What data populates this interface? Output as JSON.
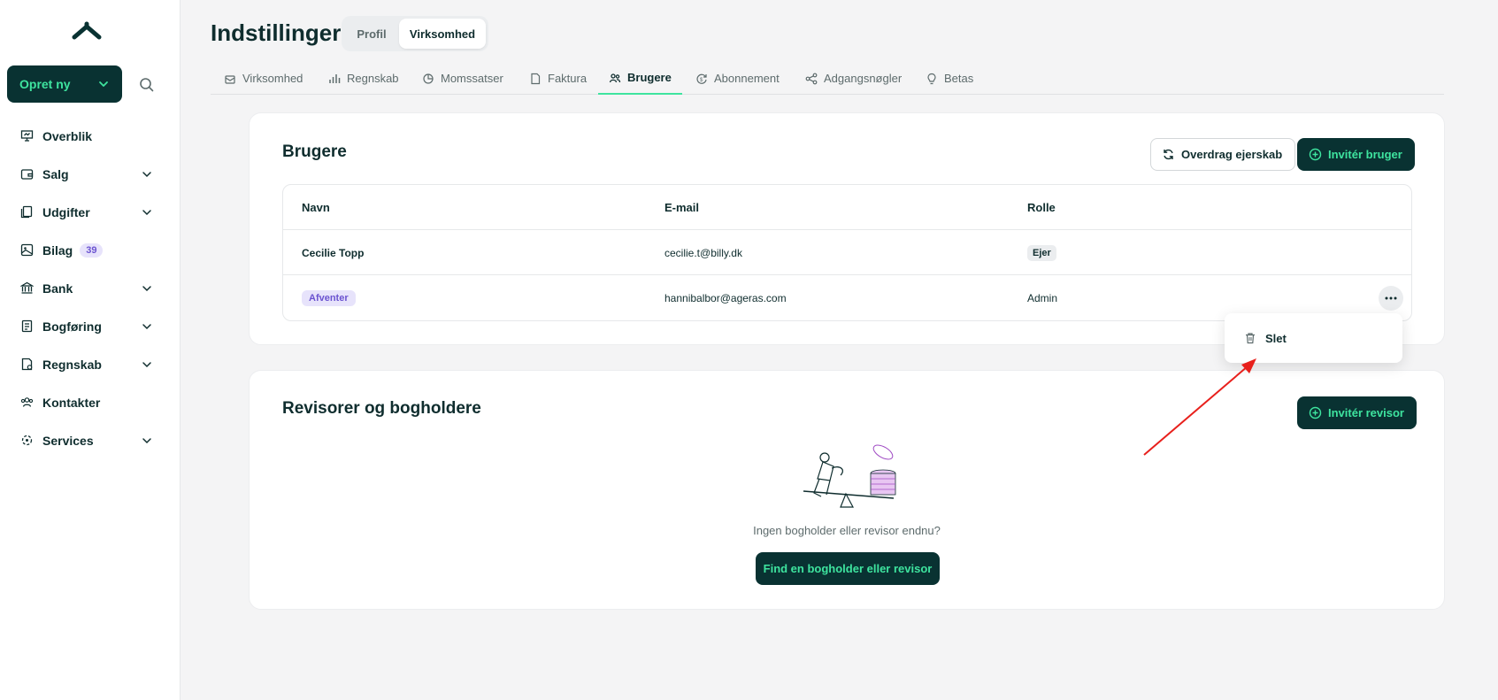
{
  "sidebar": {
    "create_label": "Opret ny",
    "items": [
      {
        "label": "Overblik",
        "icon": "presentation-icon",
        "has_chevron": false
      },
      {
        "label": "Salg",
        "icon": "wallet-icon",
        "has_chevron": true
      },
      {
        "label": "Udgifter",
        "icon": "documents-icon",
        "has_chevron": true
      },
      {
        "label": "Bilag",
        "icon": "image-icon",
        "badge": "39",
        "has_chevron": false
      },
      {
        "label": "Bank",
        "icon": "bank-icon",
        "has_chevron": true
      },
      {
        "label": "Bogføring",
        "icon": "ledger-icon",
        "has_chevron": true
      },
      {
        "label": "Regnskab",
        "icon": "report-icon",
        "has_chevron": true
      },
      {
        "label": "Kontakter",
        "icon": "contacts-icon",
        "has_chevron": false
      },
      {
        "label": "Services",
        "icon": "services-icon",
        "has_chevron": true
      }
    ]
  },
  "header": {
    "title": "Indstillinger",
    "segments": [
      "Profil",
      "Virksomhed"
    ],
    "active_segment": "Virksomhed"
  },
  "tabs": [
    {
      "label": "Virksomhed",
      "icon": "building-icon"
    },
    {
      "label": "Regnskab",
      "icon": "bar-chart-icon"
    },
    {
      "label": "Momssatser",
      "icon": "pie-chart-icon"
    },
    {
      "label": "Faktura",
      "icon": "document-icon"
    },
    {
      "label": "Brugere",
      "icon": "users-icon"
    },
    {
      "label": "Abonnement",
      "icon": "subscription-icon"
    },
    {
      "label": "Adgangsnøgler",
      "icon": "share-icon"
    },
    {
      "label": "Betas",
      "icon": "lightbulb-icon"
    }
  ],
  "active_tab": "Brugere",
  "users_card": {
    "title": "Brugere",
    "transfer_label": "Overdrag ejerskab",
    "invite_label": "Invitér bruger",
    "columns": [
      "Navn",
      "E-mail",
      "Rolle"
    ],
    "rows": [
      {
        "name": "Cecilie Topp",
        "email": "cecilie.t@billy.dk",
        "role": "Ejer"
      },
      {
        "name": "Afventer",
        "email": "hannibalbor@ageras.com",
        "role": "Admin"
      }
    ]
  },
  "dropdown": {
    "delete_label": "Slet"
  },
  "accountants_card": {
    "title": "Revisorer og bogholdere",
    "invite_label": "Invitér revisor",
    "empty_text": "Ingen bogholder eller revisor endnu?",
    "find_label": "Find en bogholder eller revisor"
  },
  "colors": {
    "brand_dark": "#093232",
    "brand_green": "#3ee49f",
    "annotation_arrow": "#e8201c",
    "pending_purple": "#6b53d0"
  }
}
